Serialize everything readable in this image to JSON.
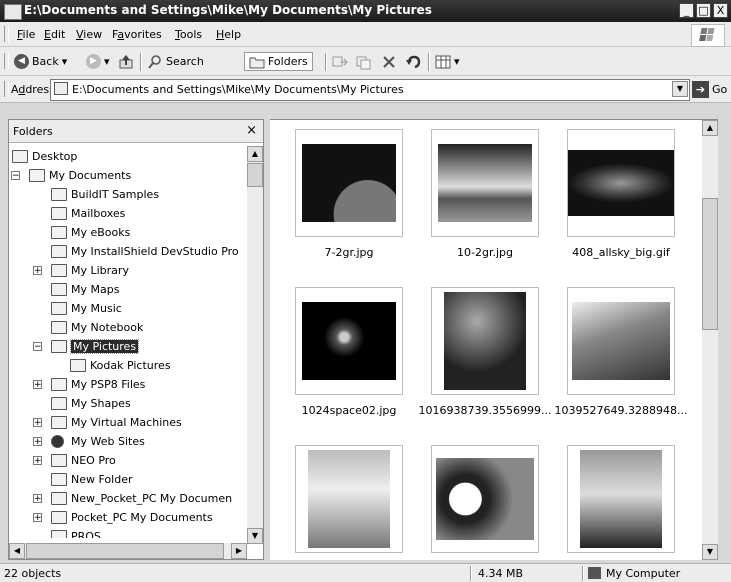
{
  "window": {
    "title": "E:\\Documents and Settings\\Mike\\My Documents\\My Pictures",
    "controls": {
      "minimize": "_",
      "maximize": "□",
      "close": "X"
    }
  },
  "menu": [
    {
      "accel": "F",
      "rest": "ile"
    },
    {
      "accel": "E",
      "rest": "dit"
    },
    {
      "accel": "V",
      "rest": "iew"
    },
    {
      "pre": "F",
      "accel": "a",
      "rest": "vorites"
    },
    {
      "accel": "T",
      "rest": "ools"
    },
    {
      "accel": "H",
      "rest": "elp"
    }
  ],
  "toolbar": {
    "back_label": "Back",
    "search_label": "Search",
    "folders_label": "Folders",
    "dropdown_glyph": "▾"
  },
  "address": {
    "label_pre": "A",
    "label_accel": "d",
    "label_rest": "dress",
    "value": "E:\\Documents and Settings\\Mike\\My Documents\\My Pictures",
    "go_label": "Go"
  },
  "folders_pane": {
    "title": "Folders",
    "close_glyph": "×",
    "items": [
      {
        "label": "Desktop",
        "expander": "",
        "icon": "desktop-icon",
        "selected": false
      },
      {
        "label": "My Documents",
        "expander": "−",
        "icon": "folder-icon",
        "selected": false
      },
      {
        "label": "BuildIT Samples",
        "expander": "",
        "icon": "folder-icon",
        "selected": false
      },
      {
        "label": "Mailboxes",
        "expander": "",
        "icon": "folder-icon",
        "selected": false
      },
      {
        "label": "My eBooks",
        "expander": "",
        "icon": "folder-icon",
        "selected": false
      },
      {
        "label": "My InstallShield DevStudio Pro",
        "expander": "",
        "icon": "folder-icon",
        "selected": false
      },
      {
        "label": "My Library",
        "expander": "+",
        "icon": "folder-icon",
        "selected": false
      },
      {
        "label": "My Maps",
        "expander": "",
        "icon": "folder-icon",
        "selected": false
      },
      {
        "label": "My Music",
        "expander": "",
        "icon": "music-folder-icon",
        "selected": false
      },
      {
        "label": "My Notebook",
        "expander": "",
        "icon": "folder-icon",
        "selected": false
      },
      {
        "label": "My Pictures",
        "expander": "−",
        "icon": "pictures-folder-icon",
        "selected": true
      },
      {
        "label": "Kodak Pictures",
        "expander": "",
        "icon": "folder-icon",
        "selected": false
      },
      {
        "label": "My PSP8 Files",
        "expander": "+",
        "icon": "folder-icon",
        "selected": false
      },
      {
        "label": "My Shapes",
        "expander": "",
        "icon": "shapes-folder-icon",
        "selected": false
      },
      {
        "label": "My Virtual Machines",
        "expander": "+",
        "icon": "folder-icon",
        "selected": false
      },
      {
        "label": "My Web Sites",
        "expander": "+",
        "icon": "web-sites-icon",
        "selected": false
      },
      {
        "label": "NEO Pro",
        "expander": "+",
        "icon": "folder-icon",
        "selected": false
      },
      {
        "label": "New Folder",
        "expander": "",
        "icon": "folder-icon",
        "selected": false
      },
      {
        "label": "New_Pocket_PC My Documen",
        "expander": "+",
        "icon": "folder-icon",
        "selected": false
      },
      {
        "label": "Pocket_PC My Documents",
        "expander": "+",
        "icon": "folder-icon",
        "selected": false
      },
      {
        "label": "PROS",
        "expander": "",
        "icon": "folder-icon",
        "selected": false
      }
    ]
  },
  "thumbnails": [
    {
      "name": "7-2gr.jpg",
      "image": "space-planet-image"
    },
    {
      "name": "10-2gr.jpg",
      "image": "mountain-sunrise-image"
    },
    {
      "name": "408_allsky_big.gif",
      "image": "allsky-map-image"
    },
    {
      "name": "1024space02.jpg",
      "image": "galaxy-image"
    },
    {
      "name": "1016938739.3556999...",
      "image": "chimpanzees-image"
    },
    {
      "name": "1039527649.3288948...",
      "image": "elephant-image"
    },
    {
      "name": "",
      "image": "white-tigers-image"
    },
    {
      "name": "",
      "image": "pandas-image"
    },
    {
      "name": "",
      "image": "penguins-image"
    }
  ],
  "status": {
    "objects": "22 objects",
    "size": "4.34 MB",
    "zone": "My Computer"
  }
}
